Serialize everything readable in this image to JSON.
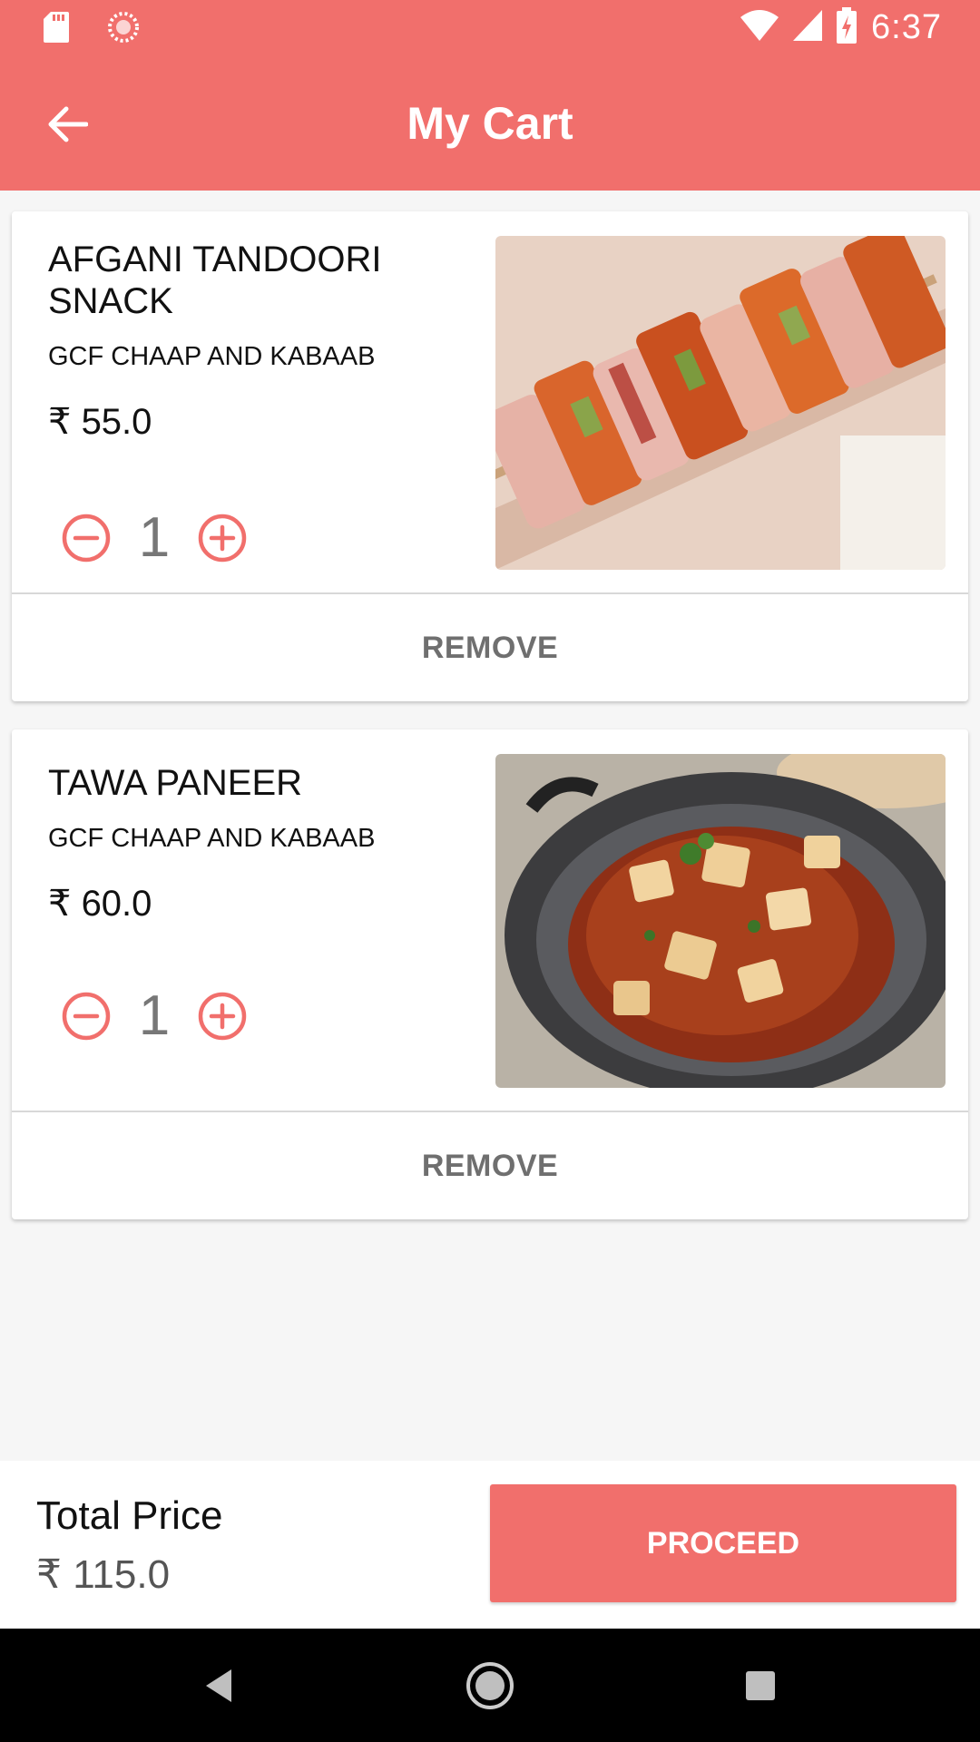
{
  "status_bar": {
    "time": "6:37",
    "icons": [
      "sd-card-icon",
      "sync-icon",
      "wifi-icon",
      "signal-icon",
      "battery-charging-icon"
    ]
  },
  "app_bar": {
    "title": "My Cart",
    "back_icon": "arrow-left-icon"
  },
  "cart": {
    "items": [
      {
        "name": "AFGANI TANDOORI SNACK",
        "vendor": "GCF CHAAP AND KABAAB",
        "price": "₹ 55.0",
        "quantity": "1",
        "remove_label": "REMOVE",
        "image": "paneer-tikka-skewers-photo"
      },
      {
        "name": "TAWA PANEER",
        "vendor": "GCF CHAAP AND KABAAB",
        "price": "₹ 60.0",
        "quantity": "1",
        "remove_label": "REMOVE",
        "image": "tawa-paneer-curry-photo"
      }
    ]
  },
  "footer": {
    "total_label": "Total Price",
    "total_value": "₹ 115.0",
    "proceed_label": "PROCEED"
  },
  "colors": {
    "accent": "#f16f6c",
    "background": "#f6f6f6",
    "card": "#ffffff",
    "navbar": "#000000"
  }
}
